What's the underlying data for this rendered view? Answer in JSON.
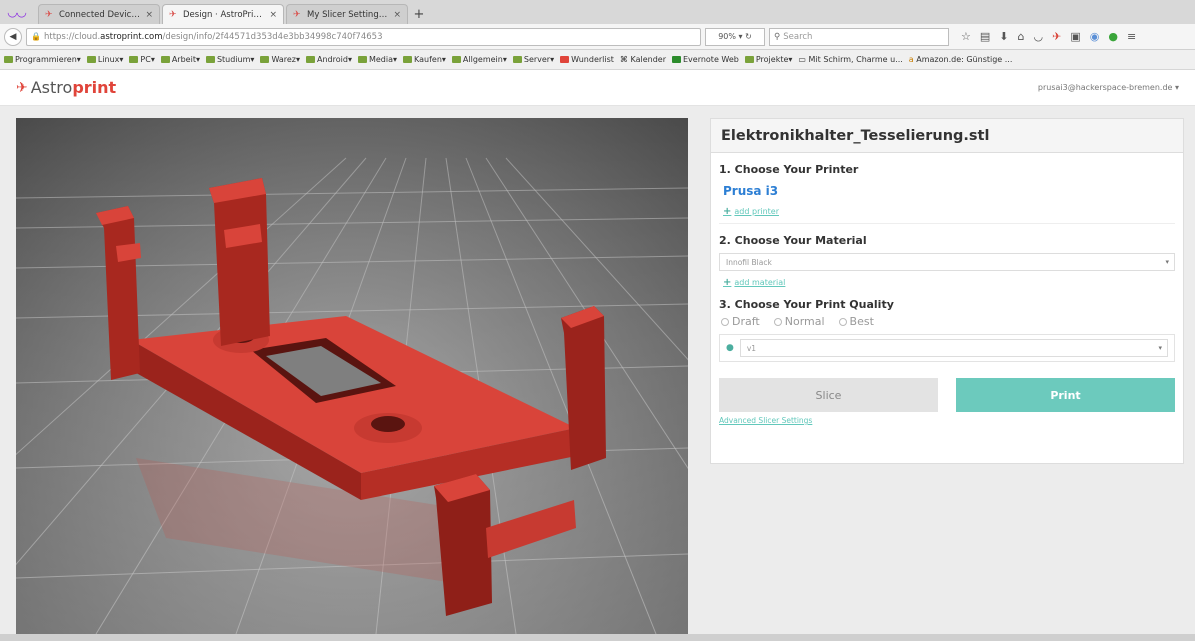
{
  "browser": {
    "tabs": [
      {
        "label": "Connected Devices -...",
        "active": false
      },
      {
        "label": "Design · AstroPrint®",
        "active": true
      },
      {
        "label": "My Slicer Settings - ...",
        "active": false
      }
    ],
    "url_prefix": "https://cloud.",
    "url_host": "astroprint.com",
    "url_path": "/design/info/2f44571d353d4e3bb34998c740f74653",
    "zoom": "90%",
    "search_placeholder": "Search",
    "bookmarks": [
      "Programmieren",
      "Linux",
      "PC",
      "Arbeit",
      "Studium",
      "Warez",
      "Android",
      "Media",
      "Kaufen",
      "Allgemein",
      "Server",
      "Wunderlist",
      "Kalender",
      "Evernote Web",
      "Projekte",
      "Mit Schirm, Charme u...",
      "Amazon.de: Günstige ..."
    ]
  },
  "app": {
    "brand_a": "Astro",
    "brand_b": "print",
    "user_email": "prusai3@hackerspace-bremen.de"
  },
  "panel": {
    "filename": "Elektronikhalter_Tesselierung.stl",
    "step1_title": "1. Choose Your Printer",
    "printer_name": "Prusa i3",
    "add_printer": "add printer",
    "step2_title": "2. Choose Your Material",
    "material_value": "Innofil Black",
    "add_material": "add material",
    "step3_title": "3. Choose Your Print Quality",
    "quality_options": [
      "Draft",
      "Normal",
      "Best"
    ],
    "profile_value": "v1",
    "slice_label": "Slice",
    "print_label": "Print",
    "advanced_link": "Advanced Slicer Settings"
  },
  "colors": {
    "accent": "#6ccabd",
    "printer_link": "#2d7fd4",
    "model": "#d9443a"
  }
}
